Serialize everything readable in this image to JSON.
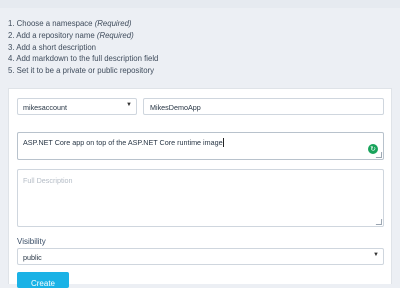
{
  "instructions": [
    {
      "text": "1. Choose a namespace ",
      "note": "(Required)"
    },
    {
      "text": "2. Add a repository name ",
      "note": "(Required)"
    },
    {
      "text": "3. Add a short description",
      "note": ""
    },
    {
      "text": "4. Add markdown to the full description field",
      "note": ""
    },
    {
      "text": "5. Set it to be a private or public repository",
      "note": ""
    }
  ],
  "form": {
    "namespace_value": "mikesaccount",
    "repo_name_value": "MikesDemoApp",
    "short_description_value": "ASP.NET Core app on top of the ASP.NET Core runtime image",
    "full_description_placeholder": "Full Description",
    "visibility_label": "Visibility",
    "visibility_value": "public",
    "create_label": "Create"
  },
  "icons": {
    "dropdown": "chevron-down-icon",
    "grammar": "grammar-check-icon"
  },
  "colors": {
    "accent": "#1ab2e6",
    "grammar_badge": "#18a35b",
    "page_background": "#eceff4"
  }
}
